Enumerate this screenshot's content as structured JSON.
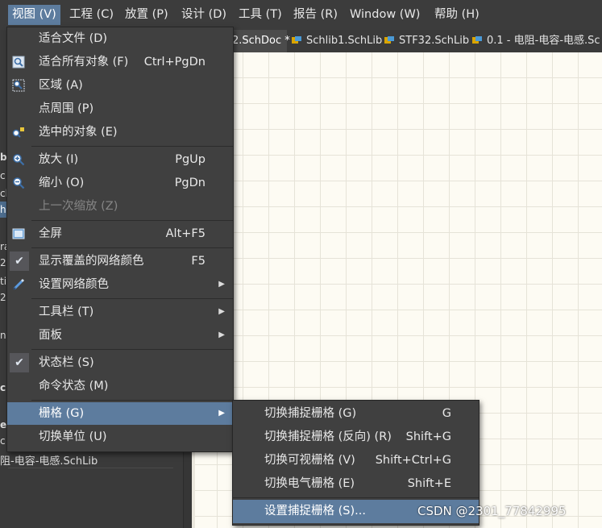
{
  "menubar": {
    "items": [
      "视图 (V)",
      "工程 (C)",
      "放置 (P)",
      "设计 (D)",
      "工具 (T)",
      "报告 (R)",
      "Window (W)",
      "帮助 (H)"
    ]
  },
  "tabs": [
    "2.SchDoc *",
    "Schlib1.SchLib",
    "STF32.SchLib",
    "0.1 - 电阻-电容-电感.Sc"
  ],
  "left_panel": {
    "fragments": [
      "b",
      "c",
      "cb",
      "h",
      "ra",
      "2.",
      "ti",
      "2.",
      "nt",
      "c",
      "e",
      "c"
    ],
    "footer_item": "阻-电容-电感.SchLib"
  },
  "view_menu": {
    "items": [
      {
        "label": "适合文件 (D)",
        "shortcut": ""
      },
      {
        "label": "适合所有对象 (F)",
        "shortcut": "Ctrl+PgDn"
      },
      {
        "label": "区域 (A)",
        "shortcut": ""
      },
      {
        "label": "点周围 (P)",
        "shortcut": ""
      },
      {
        "label": "选中的对象 (E)",
        "shortcut": ""
      },
      {
        "label": "放大 (I)",
        "shortcut": "PgUp"
      },
      {
        "label": "缩小 (O)",
        "shortcut": "PgDn"
      },
      {
        "label": "上一次缩放 (Z)",
        "shortcut": ""
      },
      {
        "label": "全屏",
        "shortcut": "Alt+F5"
      },
      {
        "label": "显示覆盖的网络颜色",
        "shortcut": "F5"
      },
      {
        "label": "设置网络颜色",
        "shortcut": ""
      },
      {
        "label": "工具栏 (T)",
        "shortcut": ""
      },
      {
        "label": "面板",
        "shortcut": ""
      },
      {
        "label": "状态栏 (S)",
        "shortcut": ""
      },
      {
        "label": "命令状态 (M)",
        "shortcut": ""
      },
      {
        "label": "栅格 (G)",
        "shortcut": ""
      },
      {
        "label": "切换单位 (U)",
        "shortcut": ""
      }
    ]
  },
  "grid_submenu": {
    "items": [
      {
        "label": "切换捕捉栅格 (G)",
        "shortcut": "G"
      },
      {
        "label": "切换捕捉栅格 (反向) (R)",
        "shortcut": "Shift+G"
      },
      {
        "label": "切换可视栅格 (V)",
        "shortcut": "Shift+Ctrl+G"
      },
      {
        "label": "切换电气栅格 (E)",
        "shortcut": "Shift+E"
      },
      {
        "label": "设置捕捉栅格 (S)...",
        "shortcut": ""
      }
    ]
  },
  "watermark": "CSDN @2301_77842995",
  "colors": {
    "menu_bg": "#404040",
    "highlight": "#5d7c9e",
    "canvas_bg": "#fdfbf3",
    "grid_line": "#e6e3d8"
  }
}
